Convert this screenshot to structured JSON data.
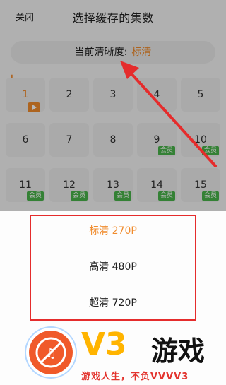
{
  "header": {
    "close_label": "关闭",
    "title": "选择缓存的集数"
  },
  "quality": {
    "label": "当前清晰度:",
    "value": "标清"
  },
  "episodes": [
    {
      "num": "1",
      "active": true,
      "badge": "play"
    },
    {
      "num": "2"
    },
    {
      "num": "3"
    },
    {
      "num": "4"
    },
    {
      "num": "5"
    },
    {
      "num": "6"
    },
    {
      "num": "7"
    },
    {
      "num": "8"
    },
    {
      "num": "9",
      "badge": "会员"
    },
    {
      "num": "10",
      "badge": "会员"
    },
    {
      "num": "11",
      "badge": "会员"
    },
    {
      "num": "12",
      "badge": "会员"
    },
    {
      "num": "13",
      "badge": "会员"
    },
    {
      "num": "14",
      "badge": "会员"
    },
    {
      "num": "15",
      "badge": "会员"
    }
  ],
  "sheet": {
    "options": [
      {
        "label": "标清 270P",
        "selected": true
      },
      {
        "label": "高清 480P"
      },
      {
        "label": "超清 720P"
      }
    ]
  },
  "watermark": {
    "brand": "V3",
    "brand_cn": "游戏",
    "slogan": "游戏人生，不负VVVV3"
  },
  "colors": {
    "accent": "#f08b2c",
    "vip": "#49b34a",
    "annotation": "#e52c2c",
    "watermark_gold": "#ffb400"
  }
}
